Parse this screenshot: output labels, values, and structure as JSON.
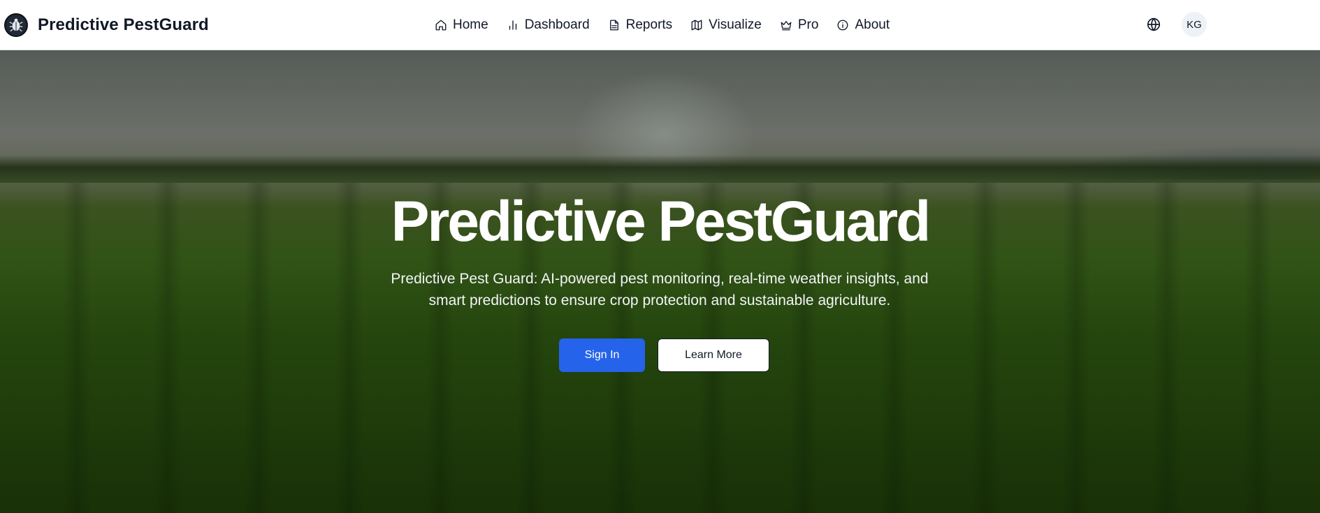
{
  "header": {
    "brand": "Predictive PestGuard",
    "nav": [
      {
        "label": "Home",
        "icon": "home-icon"
      },
      {
        "label": "Dashboard",
        "icon": "bar-chart-icon"
      },
      {
        "label": "Reports",
        "icon": "document-icon"
      },
      {
        "label": "Visualize",
        "icon": "map-icon"
      },
      {
        "label": "Pro",
        "icon": "crown-icon"
      },
      {
        "label": "About",
        "icon": "info-icon"
      }
    ],
    "language_icon": "globe-icon",
    "avatar_initials": "KG"
  },
  "hero": {
    "title": "Predictive PestGuard",
    "subtitle": "Predictive Pest Guard: AI-powered pest monitoring, real-time weather insights, and smart predictions to ensure crop protection and sustainable agriculture.",
    "primary_button": "Sign In",
    "secondary_button": "Learn More"
  },
  "colors": {
    "primary": "#2563eb",
    "text": "#111827",
    "header_bg": "#ffffff"
  }
}
